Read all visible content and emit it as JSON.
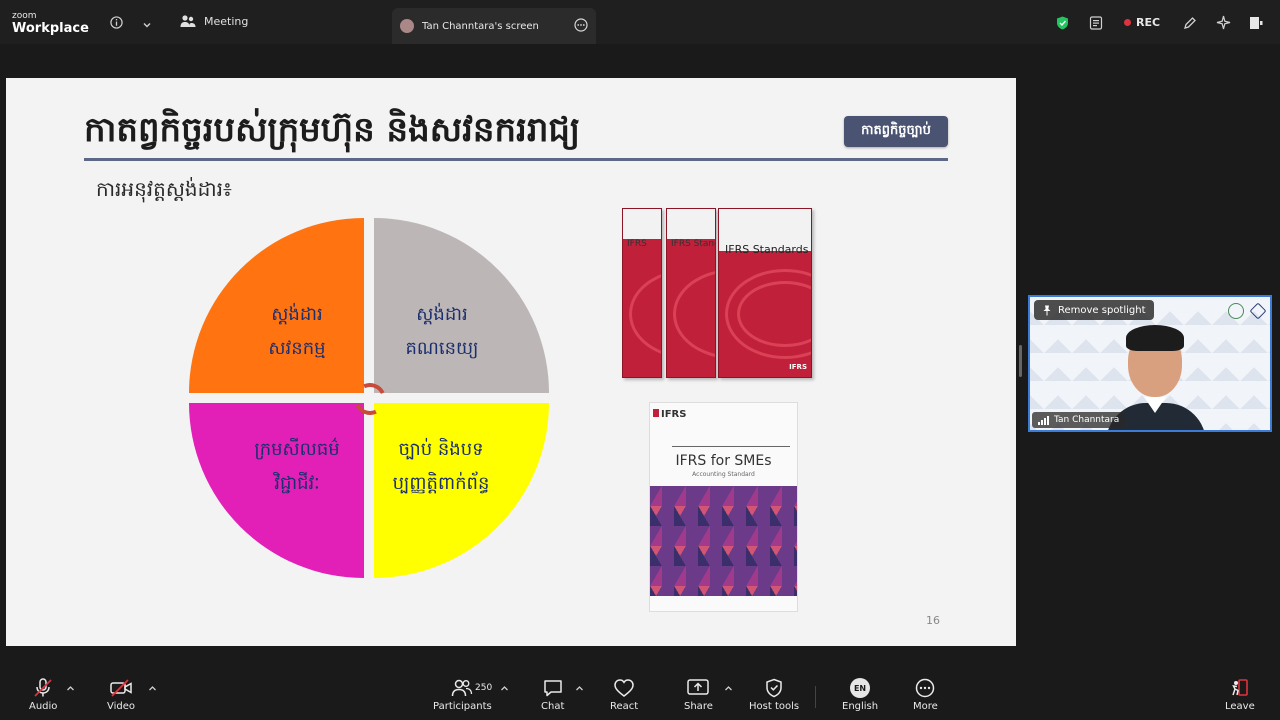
{
  "app": {
    "logo_top": "zoom",
    "logo_bottom": "Workplace"
  },
  "topbar": {
    "meeting_label": "Meeting",
    "share_tab_label": "Tan Channtara's screen",
    "rec_label": "REC"
  },
  "slide": {
    "title": "កាតព្វកិច្ចរបស់ក្រុមហ៊ុន និងសវនកររាជ្យ",
    "tag": "កាតព្វកិច្ចច្បាប់",
    "subtitle": "ការអនុវត្តស្តង់ដារ៖",
    "quadrants": [
      {
        "line1": "ស្តង់ដារ",
        "line2": "សវនកម្ម",
        "color": "#ff7310"
      },
      {
        "line1": "ស្តង់ដារ",
        "line2": "គណនេយ្យ",
        "color": "#bdb6b6"
      },
      {
        "line1": "ក្រមសីលធម៌",
        "line2": "វិជ្ជាជីវៈ",
        "color": "#e21fb6"
      },
      {
        "line1": "ច្បាប់ និងបទ",
        "line2": "ប្បញ្ញត្តិពាក់ព័ន្ធ",
        "color": "#ffff00"
      }
    ],
    "books": {
      "book1_title": "IFRS",
      "book2_title": "IFRS Standards",
      "book3_title": "IFRS Standards",
      "book3_brand": "IFRS"
    },
    "smes_book": {
      "brand": "IFRS",
      "title": "IFRS for SMEs",
      "subtitle": "Accounting Standard"
    },
    "page_number": "16"
  },
  "spotlight": {
    "remove_label": "Remove spotlight",
    "participant_name": "Tan Channtara"
  },
  "toolbar": {
    "audio": "Audio",
    "video": "Video",
    "participants": "Participants",
    "participant_count": "250",
    "chat": "Chat",
    "react": "React",
    "share": "Share",
    "host_tools": "Host tools",
    "language_badge": "EN",
    "language": "English",
    "more": "More",
    "leave": "Leave"
  },
  "colors": {
    "accent_blue": "#3c7bd6",
    "rec_red": "#e0323d",
    "secure_green": "#22c55e",
    "leave_red": "#e0323d"
  }
}
